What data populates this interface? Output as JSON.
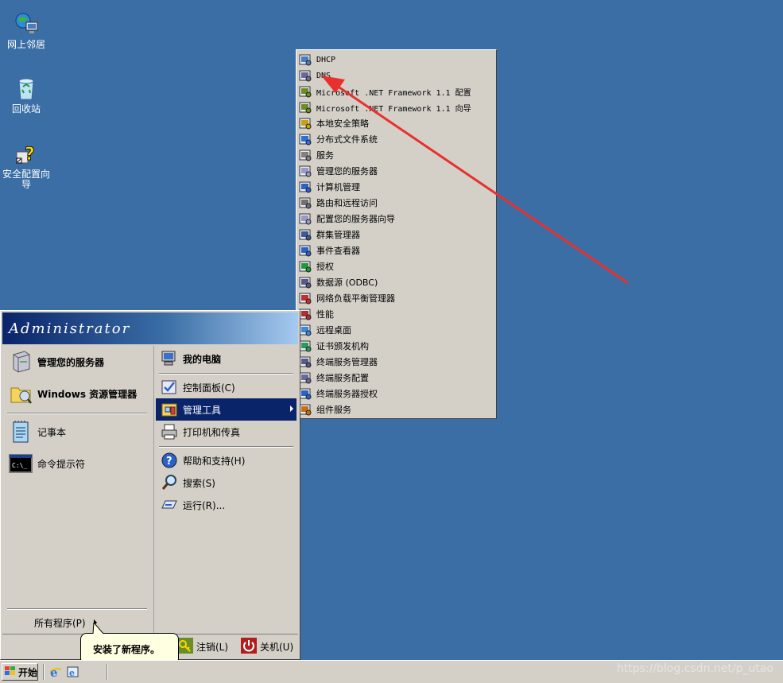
{
  "desktop": {
    "icons": [
      {
        "label": "网上邻居",
        "icon": "network-places-icon"
      },
      {
        "label": "回收站",
        "icon": "recycle-bin-icon"
      },
      {
        "label": "安全配置向导",
        "icon": "security-wizard-icon"
      }
    ]
  },
  "start_menu": {
    "user": "Administrator",
    "left_pinned": [
      {
        "label": "管理您的服务器",
        "icon": "server-manage-icon"
      },
      {
        "label": "Windows 资源管理器",
        "icon": "explorer-icon"
      }
    ],
    "left_recent": [
      {
        "label": "记事本",
        "icon": "notepad-icon"
      },
      {
        "label": "命令提示符",
        "icon": "cmd-icon"
      }
    ],
    "all_programs": "所有程序(P)",
    "right": [
      {
        "label": "我的电脑",
        "icon": "my-computer-icon"
      },
      {
        "label": "控制面板(C)",
        "icon": "control-panel-icon"
      },
      {
        "label": "管理工具",
        "icon": "admin-tools-icon",
        "selected": true
      },
      {
        "label": "打印机和传真",
        "icon": "printer-icon"
      },
      {
        "label": "帮助和支持(H)",
        "icon": "help-icon"
      },
      {
        "label": "搜索(S)",
        "icon": "search-icon"
      },
      {
        "label": "运行(R)...",
        "icon": "run-icon"
      }
    ],
    "logoff": "注销(L)",
    "shutdown": "关机(U)"
  },
  "admin_tools": [
    "DHCP",
    "DNS",
    "Microsoft .NET Framework 1.1 配置",
    "Microsoft .NET Framework 1.1 向导",
    "本地安全策略",
    "分布式文件系统",
    "服务",
    "管理您的服务器",
    "计算机管理",
    "路由和远程访问",
    "配置您的服务器向导",
    "群集管理器",
    "事件查看器",
    "授权",
    "数据源 (ODBC)",
    "网络负载平衡管理器",
    "性能",
    "远程桌面",
    "证书颁发机构",
    "终端服务管理器",
    "终端服务配置",
    "终端服务器授权",
    "组件服务"
  ],
  "taskbar": {
    "start": "开始"
  },
  "balloon": "安装了新程序。",
  "watermark": "https://blog.csdn.net/p_utao",
  "colors": {
    "desktop": "#3a6ea5",
    "menu": "#d4d0c8",
    "highlight": "#0a246a",
    "arrow": "#e8302e"
  }
}
